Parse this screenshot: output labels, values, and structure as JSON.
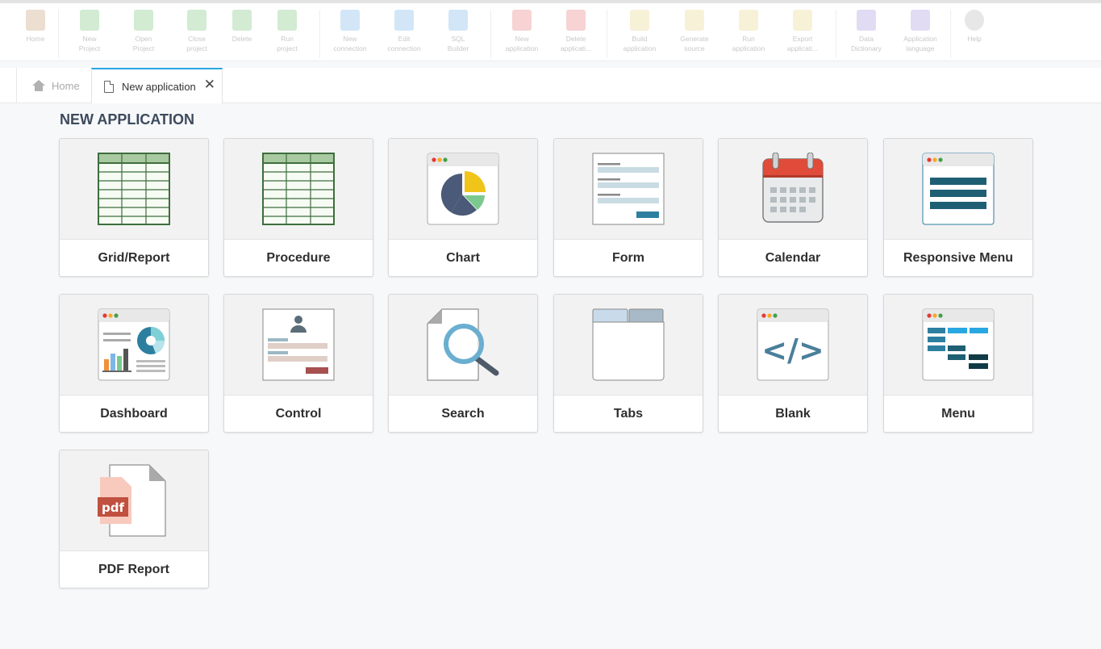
{
  "toolbar": {
    "buttons": [
      {
        "label": "Home",
        "color": "#c9a07a"
      },
      {
        "label": "New\nProject",
        "color": "#7fc77f"
      },
      {
        "label": "Open\nProject",
        "color": "#7fc77f"
      },
      {
        "label": "Close\nproject",
        "color": "#7fc77f"
      },
      {
        "label": "Delete",
        "color": "#7fc77f"
      },
      {
        "label": "Run\nproject",
        "color": "#7fc77f"
      },
      {
        "label": "New\nconnection",
        "color": "#7fb6e8"
      },
      {
        "label": "Edit\nconnection",
        "color": "#7fb6e8"
      },
      {
        "label": "SQL\nBuilder",
        "color": "#7fb6e8"
      },
      {
        "label": "New\napplication",
        "color": "#e88080"
      },
      {
        "label": "Delete\napplicati...",
        "color": "#e88080"
      },
      {
        "label": "Build\napplication",
        "color": "#e8d890"
      },
      {
        "label": "Generate\nsource",
        "color": "#e8d890"
      },
      {
        "label": "Run\napplication",
        "color": "#e8d890"
      },
      {
        "label": "Export\napplicati...",
        "color": "#e8d890"
      },
      {
        "label": "Data\nDictionary",
        "color": "#a99ae0"
      },
      {
        "label": "Application\nlanguage",
        "color": "#a99ae0"
      },
      {
        "label": "Help",
        "color": "#bbbbbb"
      }
    ]
  },
  "tabs": {
    "home_label": "Home",
    "active_label": "New application",
    "close_glyph": "✕"
  },
  "page_title": "NEW APPLICATION",
  "cards": [
    {
      "label": "Grid/Report"
    },
    {
      "label": "Procedure"
    },
    {
      "label": "Chart"
    },
    {
      "label": "Form"
    },
    {
      "label": "Calendar"
    },
    {
      "label": "Responsive Menu"
    },
    {
      "label": "Dashboard"
    },
    {
      "label": "Control"
    },
    {
      "label": "Search"
    },
    {
      "label": "Tabs"
    },
    {
      "label": "Blank"
    },
    {
      "label": "Menu"
    },
    {
      "label": "PDF Report"
    }
  ],
  "icons": {
    "blank_code": "</>",
    "pdf_text": "pdf"
  },
  "colors": {
    "accent": "#29a7e1",
    "grid_green": "#3d6e3d",
    "calendar_red": "#e04b3a",
    "menu_teal": "#1f5f73",
    "pdf_red": "#c0503f"
  }
}
